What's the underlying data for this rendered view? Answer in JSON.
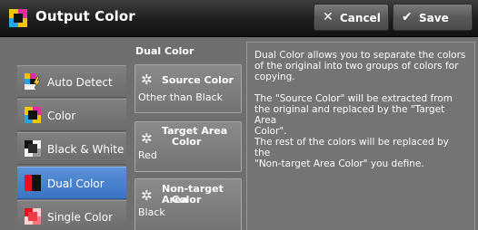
{
  "header": {
    "title": "Output Color",
    "cancel_label": "Cancel",
    "save_label": "Save"
  },
  "options": [
    {
      "label": "Auto Detect",
      "icon": "auto-detect-icon"
    },
    {
      "label": "Color",
      "icon": "color-icon"
    },
    {
      "label": "Black & White",
      "icon": "black-white-icon"
    },
    {
      "label": "Dual Color",
      "icon": "dual-color-icon",
      "selected": true
    },
    {
      "label": "Single Color",
      "icon": "single-color-icon"
    }
  ],
  "dual_color": {
    "heading": "Dual Color",
    "source": {
      "title": "Source Color",
      "value": "Other than Black"
    },
    "target": {
      "title_line1": "Target Area",
      "title_line2": "Color",
      "value": "Red"
    },
    "non_target": {
      "title_line1": "Non-target Area",
      "title_line2": "Color",
      "value": "Black"
    }
  },
  "description": {
    "para1": "Dual Color allows you to separate the colors\nof the original into two groups of colors for\ncopying.",
    "para2": "The \"Source Color\" will be extracted from\nthe original and replaced by the \"Target Area\nColor\".\nThe rest of the colors will be replaced by the\n\"Non-target Area Color\" you define."
  },
  "colors": {
    "selected": "#4a86d0",
    "header": "#1e1e1e",
    "background": "#6f6f6f"
  }
}
